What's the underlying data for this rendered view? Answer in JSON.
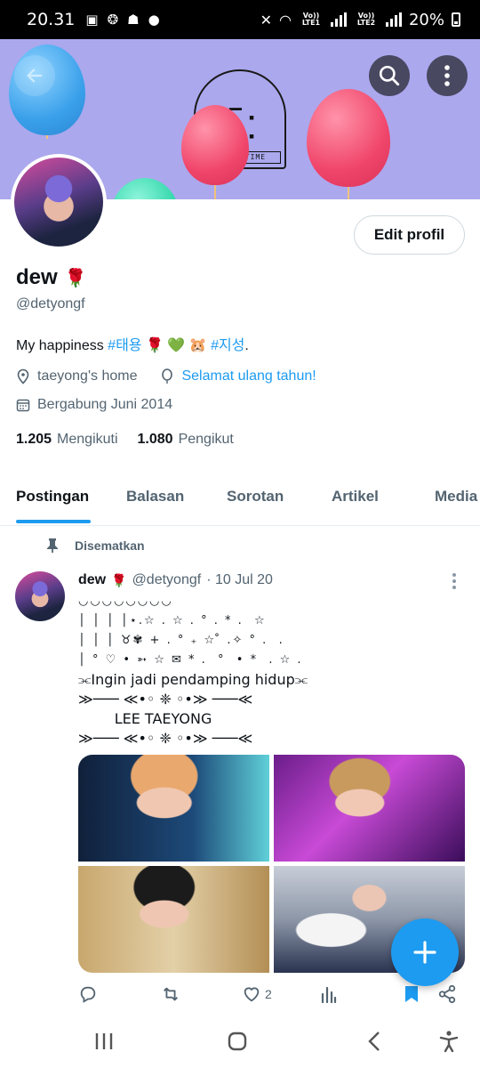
{
  "status_bar": {
    "time": "20.31",
    "lte1": "Vo)) LTE1",
    "lte2": "Vo)) LTE2",
    "battery": "20%"
  },
  "banner": {
    "arch_label": "TYONG-TIME",
    "arch_face": "-̄ -̄"
  },
  "profile": {
    "name": "dew",
    "name_emoji": "🌹",
    "handle": "@detyongf",
    "edit_button": "Edit profil",
    "bio_text": "My happiness ",
    "bio_hashtag1": "#태용",
    "bio_emojis": " 🌹 💚 🐹 ",
    "bio_hashtag2": "#지성",
    "bio_end": ".",
    "location": "taeyong's home",
    "link": "Selamat ulang tahun!",
    "joined": "Bergabung Juni 2014",
    "following_count": "1.205",
    "following_label": "Mengikuti",
    "followers_count": "1.080",
    "followers_label": "Pengikut"
  },
  "tabs": [
    {
      "label": "Postingan"
    },
    {
      "label": "Balasan"
    },
    {
      "label": "Sorotan"
    },
    {
      "label": "Artikel"
    },
    {
      "label": "Media"
    }
  ],
  "pinned_label": "Disematkan",
  "post": {
    "author": "dew",
    "author_emoji": "🌹",
    "handle": "@detyongf",
    "date": "· 10 Jul 20",
    "deco_lines": [
      "◡◡◡◡◡◡◡◡",
      "│ │ │ │⋆.☆ . ☆ . ° . * .  ☆",
      "│ │ │ ♉✾ + . ° ₊ ☆ ̊ .✧ ° .  .",
      "│ ° ♡ • ➳ ☆ ✉ * .  °  • *  . ☆ ."
    ],
    "line1": "⫘Ingin jadi pendamping hidup⫘",
    "line2": "≫─── ≪•◦ ❈ ◦•≫ ───≪",
    "line3": "        LEE TAEYONG",
    "line4": "≫─── ≪•◦ ❈ ◦•≫ ───≪",
    "like_count": "2"
  },
  "icons": {
    "search": "search-icon",
    "more": "more-vertical-icon",
    "fab": "plus-icon"
  },
  "colors": {
    "accent": "#1d9bf0",
    "banner": "#aba8ee",
    "muted": "#536471"
  }
}
